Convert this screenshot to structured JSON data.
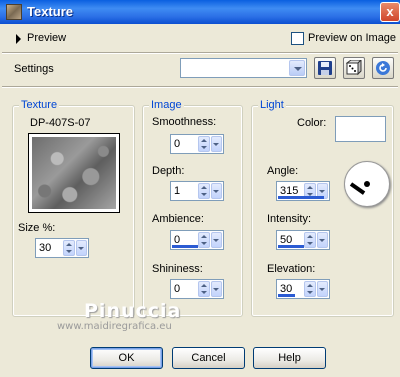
{
  "window": {
    "title": "Texture",
    "close_glyph": "x"
  },
  "preview": {
    "label": "Preview",
    "preview_on_image_label": "Preview on Image",
    "preview_on_image_checked": false
  },
  "settings": {
    "label": "Settings",
    "value": ""
  },
  "texture": {
    "legend": "Texture",
    "name": "DP-407S-07",
    "size_label": "Size %:",
    "size_value": "30"
  },
  "image": {
    "legend": "Image",
    "smoothness_label": "Smoothness:",
    "smoothness_value": "0",
    "smoothness_fraction": 0,
    "depth_label": "Depth:",
    "depth_value": "1",
    "depth_fraction": 0.0,
    "ambience_label": "Ambience:",
    "ambience_value": "0",
    "ambience_fraction": 0.5,
    "shininess_label": "Shininess:",
    "shininess_value": "0",
    "shininess_fraction": 0
  },
  "light": {
    "legend": "Light",
    "color_label": "Color:",
    "color_value": "#ffffff",
    "angle_label": "Angle:",
    "angle_value": "315",
    "angle_fraction": 0.875,
    "intensity_label": "Intensity:",
    "intensity_value": "50",
    "intensity_fraction": 0.5,
    "elevation_label": "Elevation:",
    "elevation_value": "30",
    "elevation_fraction": 0.33
  },
  "watermark": {
    "name": "Pinuccia",
    "url": "www.maidiregrafica.eu"
  },
  "buttons": {
    "ok": "OK",
    "cancel": "Cancel",
    "help": "Help"
  },
  "colors": {
    "title_bar": "#0a5fe0",
    "group_legend": "#0046d5",
    "slider_fill": "#2b5bd3"
  }
}
